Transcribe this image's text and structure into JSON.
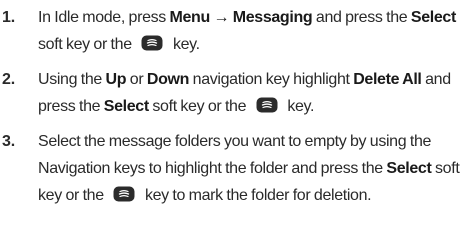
{
  "steps": [
    {
      "number": "1.",
      "parts": [
        {
          "t": "In Idle mode, press ",
          "b": false
        },
        {
          "t": "Menu",
          "b": true
        },
        {
          "t": " → ",
          "b": true
        },
        {
          "t": "Messaging",
          "b": true
        },
        {
          "t": " and press the ",
          "b": false
        },
        {
          "t": "Select",
          "b": true
        },
        {
          "t": " soft key or the ",
          "b": false
        },
        {
          "icon": "select-key-icon"
        },
        {
          "t": " key.",
          "b": false
        }
      ]
    },
    {
      "number": "2.",
      "parts": [
        {
          "t": "Using the ",
          "b": false
        },
        {
          "t": "Up",
          "b": true
        },
        {
          "t": " or ",
          "b": false
        },
        {
          "t": "Down",
          "b": true
        },
        {
          "t": " navigation key highlight ",
          "b": false
        },
        {
          "t": "Delete All",
          "b": true
        },
        {
          "t": " and press the ",
          "b": false
        },
        {
          "t": "Select",
          "b": true
        },
        {
          "t": " soft key or the ",
          "b": false
        },
        {
          "icon": "select-key-icon"
        },
        {
          "t": " key.",
          "b": false
        }
      ]
    },
    {
      "number": "3.",
      "parts": [
        {
          "t": "Select the message folders you want to empty by using the Navigation keys to highlight the folder and press the ",
          "b": false
        },
        {
          "t": "Select",
          "b": true
        },
        {
          "t": " soft key or the ",
          "b": false
        },
        {
          "icon": "select-key-icon"
        },
        {
          "t": " key to mark the folder for deletion.",
          "b": false
        }
      ]
    }
  ],
  "colors": {
    "text": "#2a2a2a",
    "icon_fill": "#2b2b2b",
    "icon_mark": "#ffffff"
  }
}
